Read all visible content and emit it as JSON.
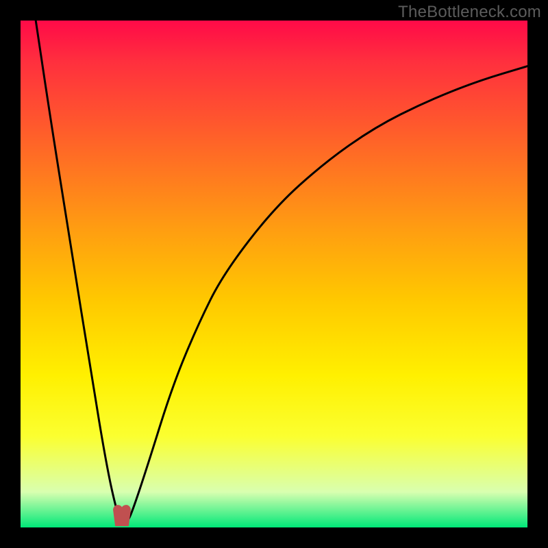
{
  "watermark": "TheBottleneck.com",
  "colors": {
    "background": "#000000",
    "curve": "#000000",
    "marker": "#c05050",
    "gradient_top": "#ff0a48",
    "gradient_bottom": "#00e878"
  },
  "chart_data": {
    "type": "line",
    "title": "",
    "xlabel": "",
    "ylabel": "",
    "xlim": [
      0,
      100
    ],
    "ylim": [
      0,
      100
    ],
    "grid": false,
    "legend": false,
    "description": "Bottleneck-style curve: V-shaped dip to near zero around x≈20, steep on left side, gradual asymptotic rise on right toward ~90. Small U-shaped marker at trough.",
    "series": [
      {
        "name": "bottleneck-curve",
        "x": [
          3,
          6,
          10,
          14,
          17,
          19,
          20,
          21,
          22,
          25,
          30,
          35,
          40,
          50,
          60,
          70,
          80,
          90,
          100
        ],
        "y": [
          100,
          80,
          55,
          30,
          12,
          3,
          1,
          1,
          3,
          12,
          28,
          40,
          50,
          63,
          72,
          79,
          84,
          88,
          91
        ]
      }
    ],
    "marker": {
      "name": "trough-u-marker",
      "x": [
        19.2,
        19.5,
        20.5,
        20.8
      ],
      "y": [
        3.5,
        1.2,
        1.2,
        3.5
      ]
    }
  }
}
